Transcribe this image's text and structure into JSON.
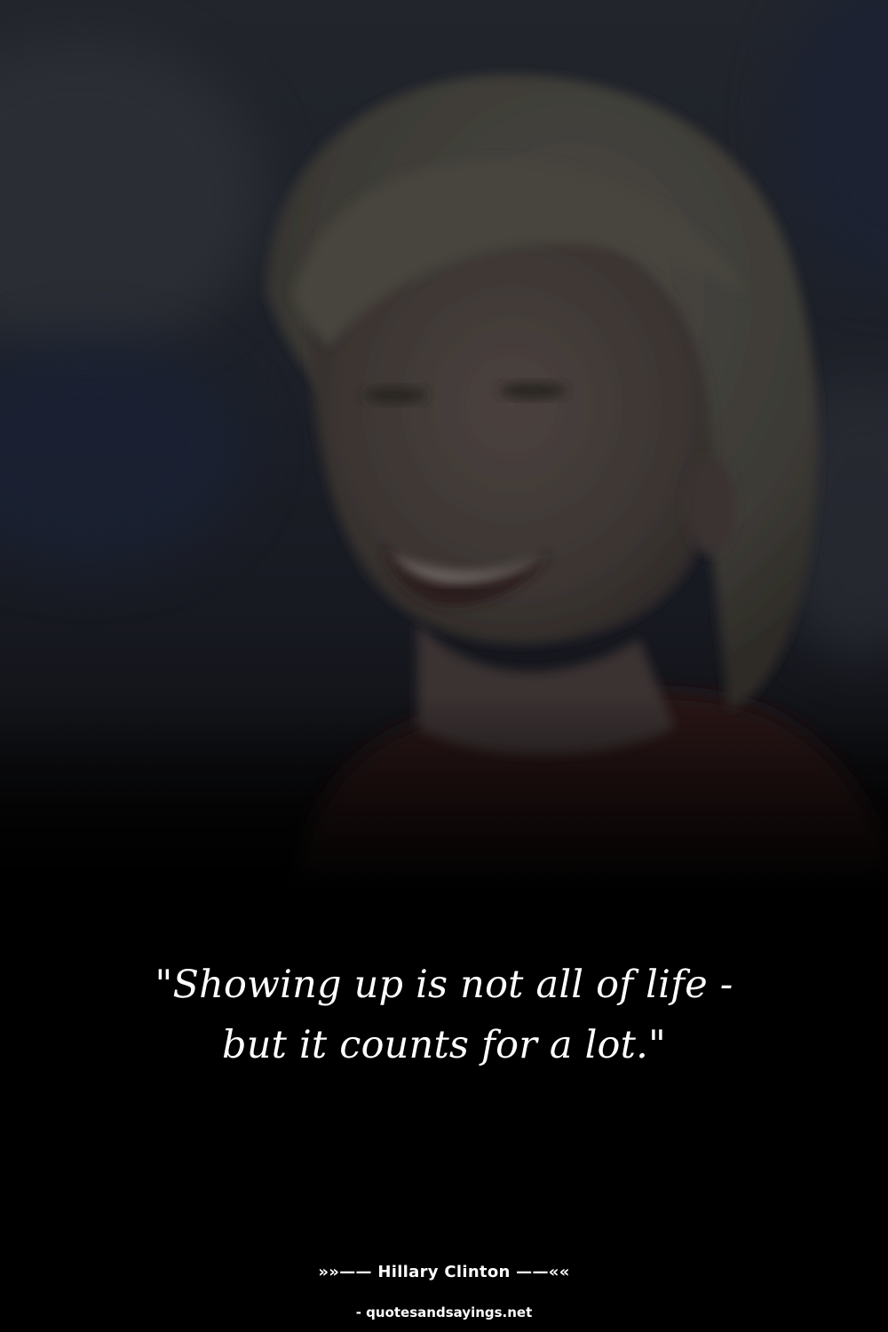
{
  "quote": {
    "text": "\"Showing up is not all of life - but it counts for a lot.\""
  },
  "attribution": {
    "text": "»»—— Hillary Clinton ——««"
  },
  "source": {
    "text": "- quotesandsayings.net"
  },
  "colors": {
    "background": "#000000",
    "text": "#ffffff"
  }
}
